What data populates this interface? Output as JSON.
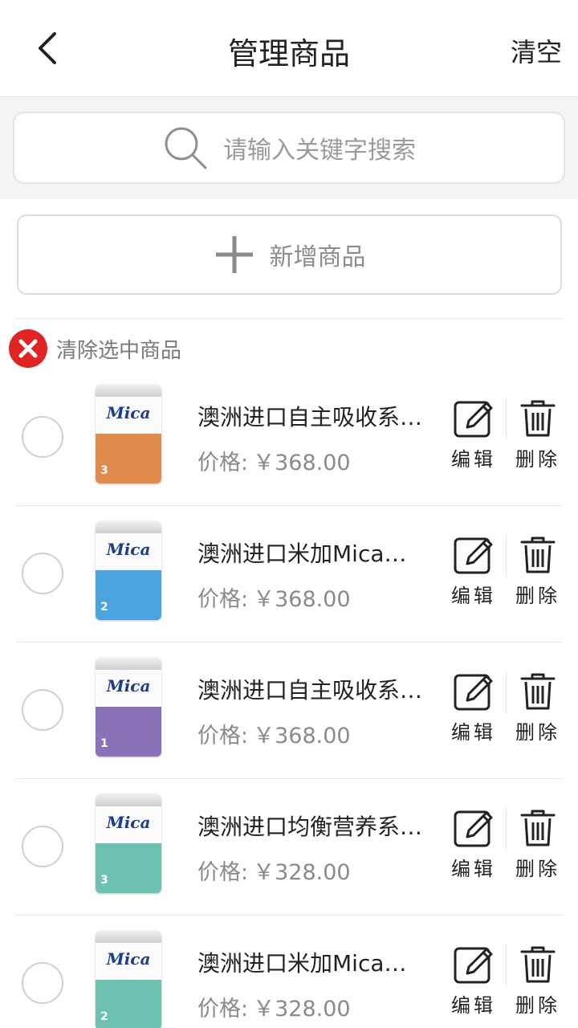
{
  "header": {
    "title": "管理商品",
    "clear_label": "清空"
  },
  "search": {
    "placeholder": "请输入关键字搜索"
  },
  "add_button": {
    "label": "新增商品"
  },
  "clear_selected": {
    "label": "清除选中商品"
  },
  "price_label": "价格:",
  "actions": {
    "edit": "编辑",
    "delete": "删除"
  },
  "products": [
    {
      "name": "澳洲进口自主吸收系…",
      "price": "￥368.00",
      "can_color": "#e08a4e",
      "can_num": "3"
    },
    {
      "name": "澳洲进口米加Mica…",
      "price": "￥368.00",
      "can_color": "#4aa3dc",
      "can_num": "2"
    },
    {
      "name": "澳洲进口自主吸收系…",
      "price": "￥368.00",
      "can_color": "#8a72b8",
      "can_num": "1"
    },
    {
      "name": "澳洲进口均衡营养系…",
      "price": "￥328.00",
      "can_color": "#6cc1b0",
      "can_num": "3"
    },
    {
      "name": "澳洲进口米加Mica…",
      "price": "￥328.00",
      "can_color": "#6cc1b0",
      "can_num": "2"
    }
  ],
  "can_logo_text": "Mica",
  "colors": {
    "accent_red": "#e02424",
    "muted_gray": "#8a8a8a"
  }
}
